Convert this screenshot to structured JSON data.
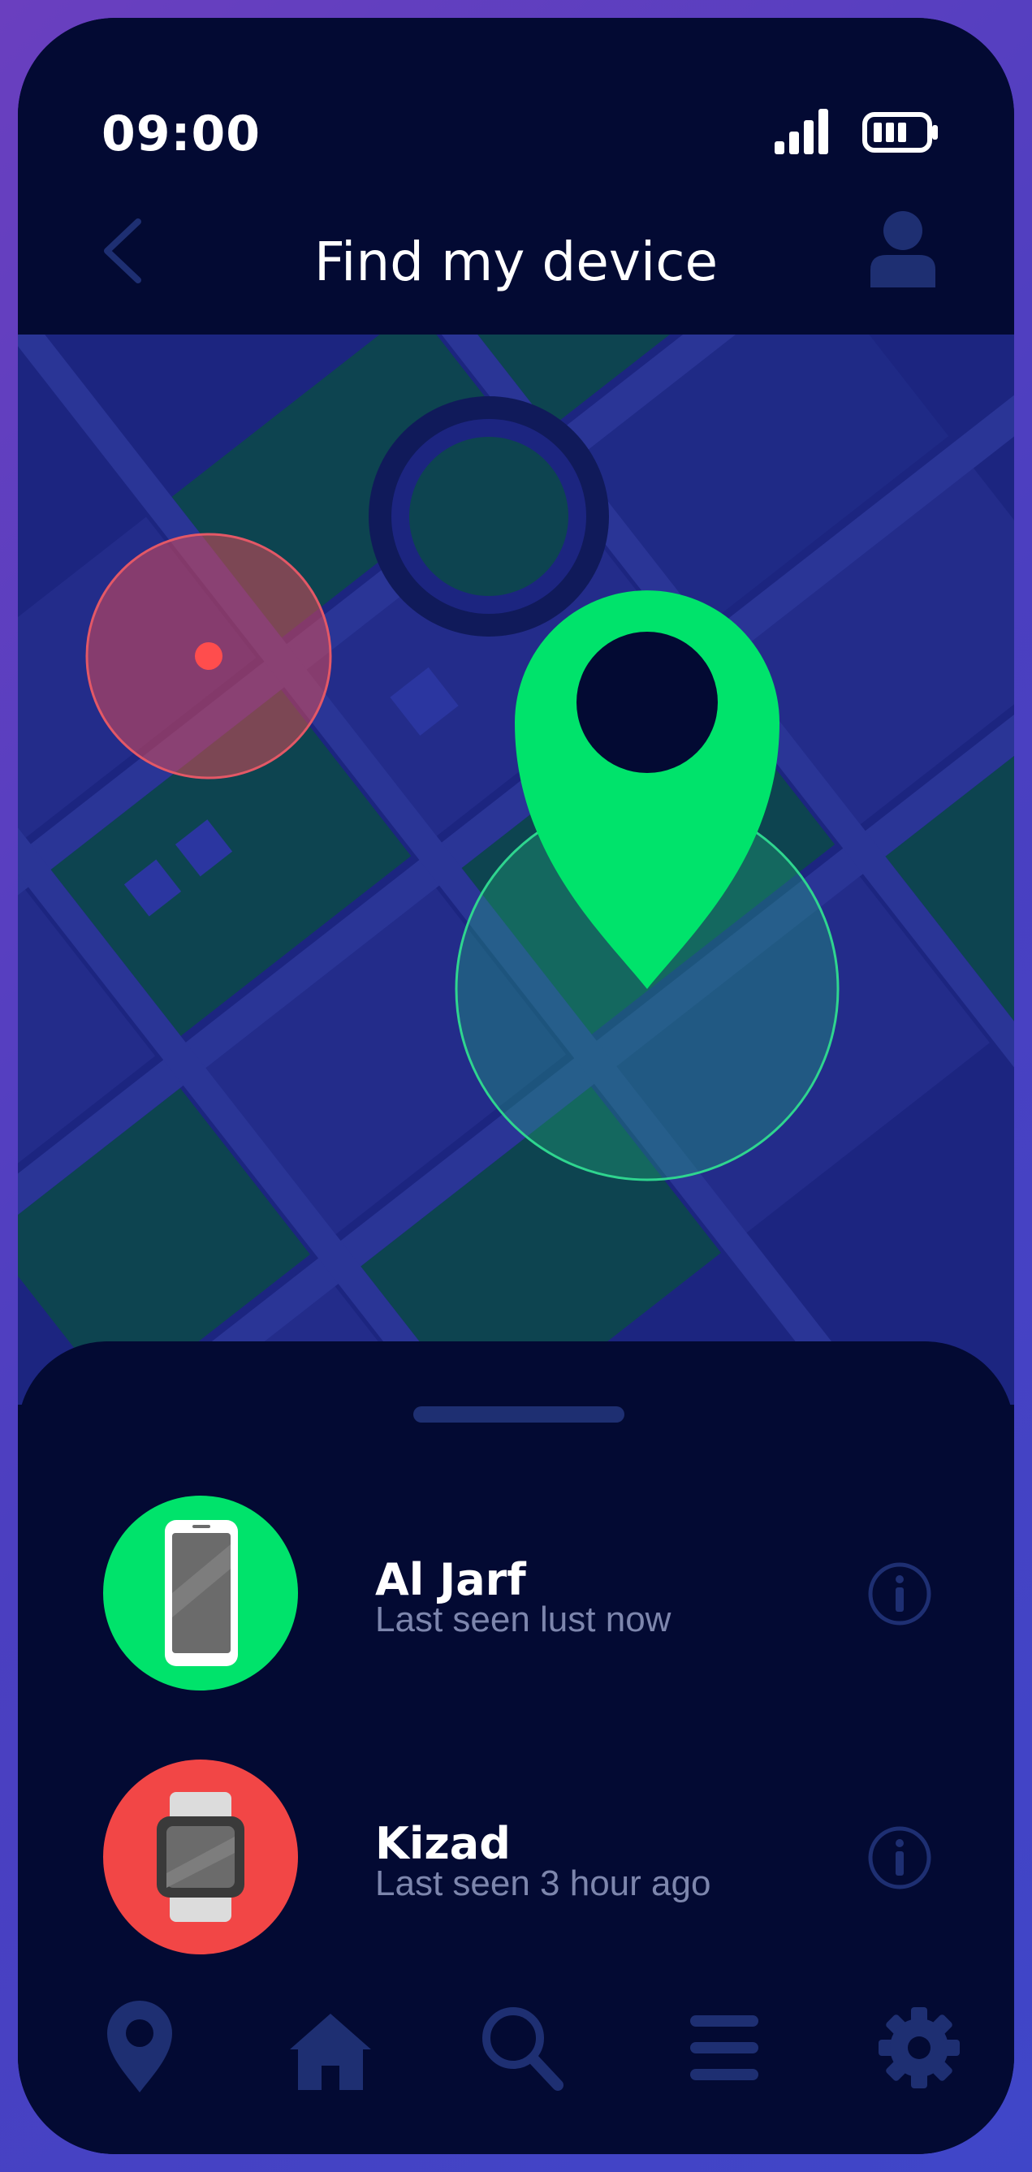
{
  "status_bar": {
    "time": "09:00",
    "icons": [
      "signal-icon",
      "battery-icon"
    ]
  },
  "header": {
    "title": "Find my device",
    "left_icon": "back-arrow-icon",
    "right_icon": "profile-icon"
  },
  "map": {
    "markers": [
      "location-pin-icon",
      "device-location-dot"
    ]
  },
  "devices": [
    {
      "name": "Al Jarf",
      "last_seen": "Last seen lust now",
      "icon": "smartphone-icon",
      "color": "#00e36b"
    },
    {
      "name": "Kizad",
      "last_seen": "Last seen 3 hour ago",
      "icon": "smartwatch-icon",
      "color": "#f24646"
    }
  ],
  "bottom_nav": [
    "location-icon",
    "home-icon",
    "search-icon",
    "menu-icon",
    "settings-icon"
  ],
  "colors": {
    "background": "#030a33",
    "map_base": "#1a2277",
    "map_green": "#0d4450",
    "accent_green": "#00e36b",
    "accent_red": "#f24646",
    "muted": "#1e2f72"
  }
}
